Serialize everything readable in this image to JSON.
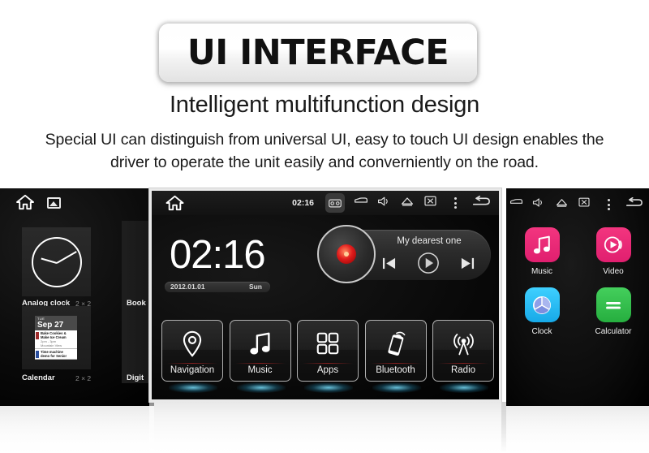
{
  "header": {
    "banner_title": "UI INTERFACE",
    "subtitle": "Intelligent multifunction design",
    "description_line1": "Special UI can distinguish from universal UI, easy to touch UI design enables the",
    "description_line2": "driver to operate the unit easily and converniently on the road."
  },
  "left_screen": {
    "statusbar": {
      "home_icon": "home-icon",
      "gallery_icon": "gallery-icon"
    },
    "widgets": [
      {
        "label": "Analog clock",
        "size": "2 × 2",
        "icon": "analog-clock-widget"
      },
      {
        "label": "Calendar",
        "size": "2 × 2",
        "icon": "calendar-widget"
      }
    ],
    "calendar_widget": {
      "day_of_week": "TUE",
      "date": "Sep 27",
      "events": [
        {
          "title": "Bake Cookies &",
          "title2": "Make Ice Cream",
          "time": "2pm - 3pm",
          "place": "Mountain View",
          "color": "#9e2b2b"
        },
        {
          "title": "Time machine",
          "title2": "demo for Senior",
          "time": "",
          "place": "",
          "color": "#2b4f9e"
        }
      ]
    },
    "peek_labels": [
      "Book",
      "Digit"
    ]
  },
  "center_screen": {
    "statusbar": {
      "home_icon": "home-icon",
      "clock": "02:16",
      "icons": [
        "radio-icon",
        "car-icon",
        "volume-icon",
        "eject-icon",
        "screen-off-icon",
        "more-vertical-icon",
        "back-icon"
      ]
    },
    "clock": {
      "time": "02:16",
      "date": "2012.01.01",
      "weekday": "Sun"
    },
    "player": {
      "track_title": "My dearest one",
      "prev_icon": "previous-track-icon",
      "play_icon": "play-icon",
      "next_icon": "next-track-icon",
      "disc_icon": "vinyl-disc-icon"
    },
    "apps": [
      {
        "label": "Navigation",
        "icon": "location-pin-icon"
      },
      {
        "label": "Music",
        "icon": "music-note-icon"
      },
      {
        "label": "Apps",
        "icon": "grid-apps-icon"
      },
      {
        "label": "Bluetooth",
        "icon": "phone-bluetooth-icon"
      },
      {
        "label": "Radio",
        "icon": "radio-tower-icon"
      }
    ]
  },
  "right_screen": {
    "statusbar": {
      "icons": [
        "car-icon",
        "volume-icon",
        "eject-icon",
        "screen-off-icon",
        "more-vertical-icon",
        "back-icon"
      ]
    },
    "apps": [
      {
        "label": "Music",
        "icon": "music-note-icon",
        "color": "#ec2a7b"
      },
      {
        "label": "Video",
        "icon": "video-play-icon",
        "color": "#ec2a7b"
      },
      {
        "label": "Clock",
        "icon": "clock-pie-icon",
        "color": "#2ec2f0"
      },
      {
        "label": "Calculator",
        "icon": "calculator-equals-icon",
        "color": "#2fbf4a"
      }
    ]
  },
  "colors": {
    "accent_pink": "#ec2a7b",
    "accent_blue": "#2ec2f0",
    "accent_green": "#2fbf4a",
    "glow_cyan": "#78e1ff",
    "disc_red": "#e01c1c",
    "page_bg": "#ffffff",
    "screen_bg": "#000000"
  }
}
